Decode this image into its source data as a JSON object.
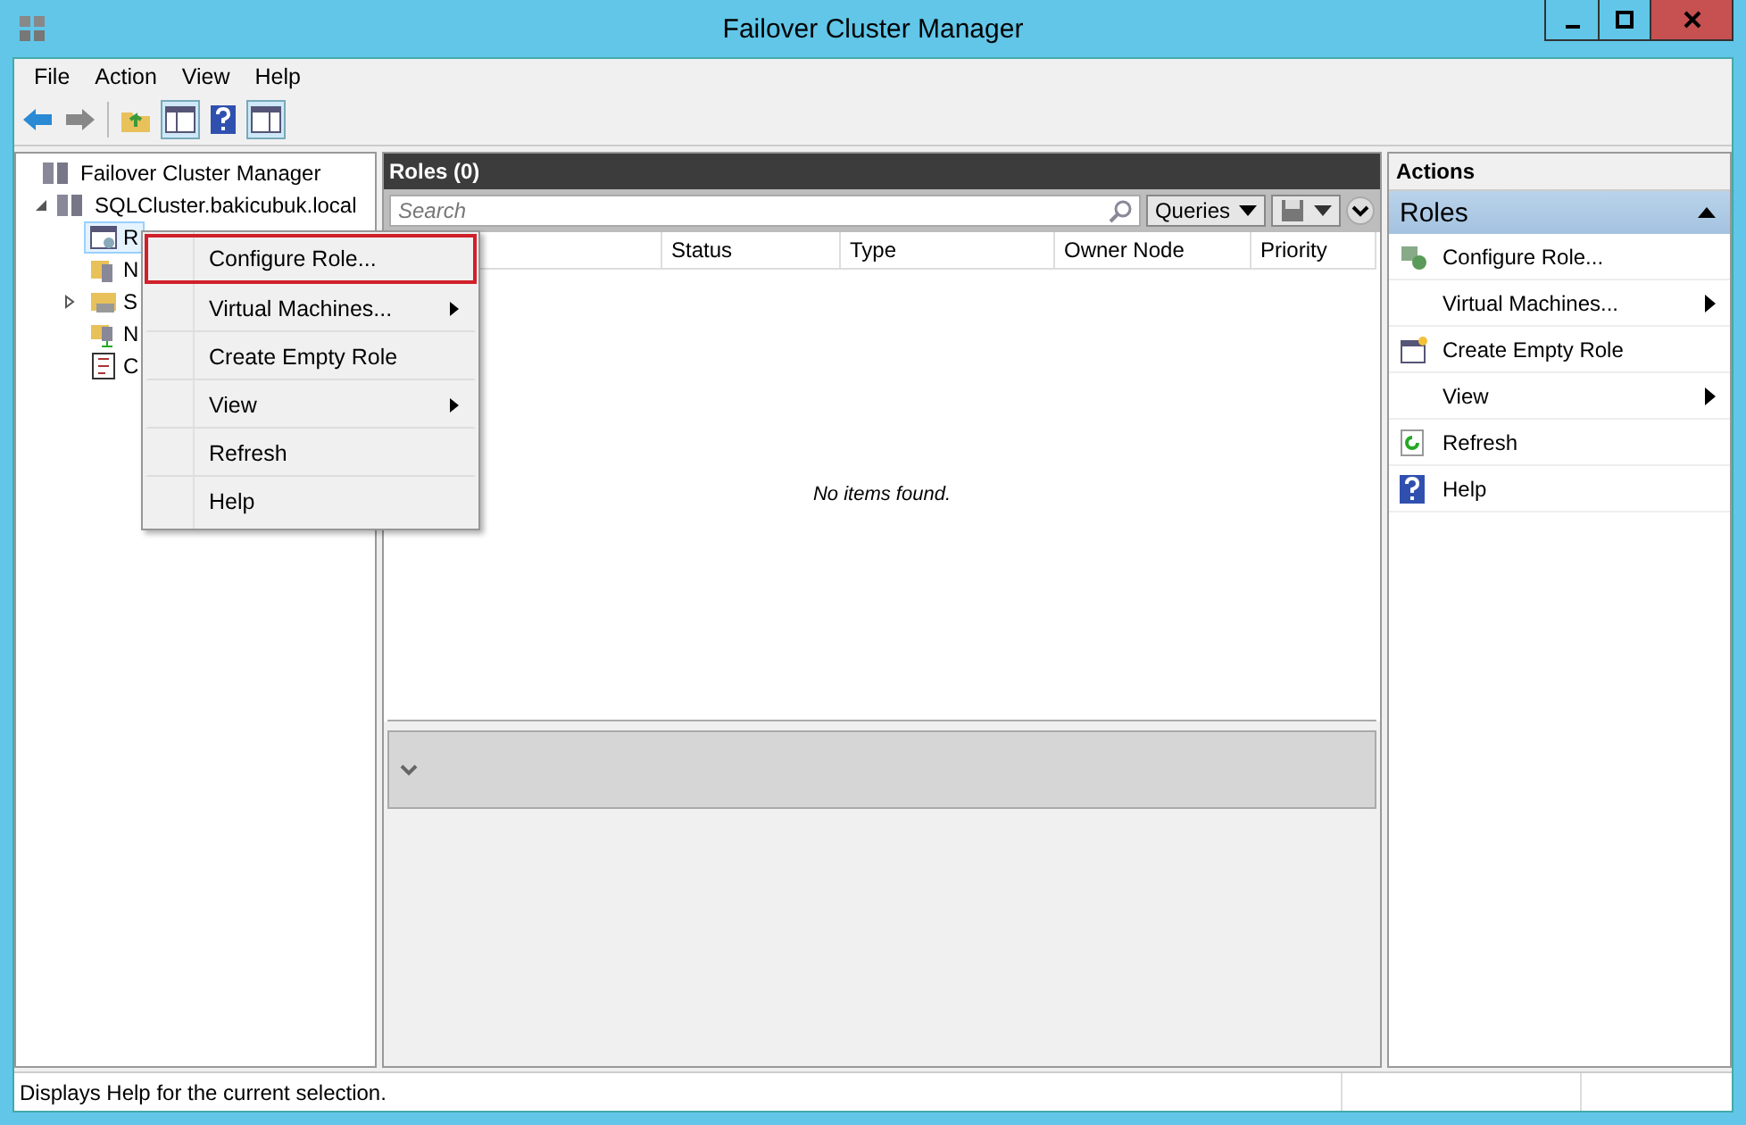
{
  "window": {
    "title": "Failover Cluster Manager"
  },
  "menu_bar": [
    "File",
    "Action",
    "View",
    "Help"
  ],
  "tree": [
    {
      "label": "Failover Cluster Manager",
      "selected": false,
      "children": [
        {
          "label": "SQLCluster.bakicubuk.local",
          "expanded": true,
          "selected": false,
          "children": [
            {
              "label": "R",
              "kind": "roles",
              "selected": true
            },
            {
              "label": "N",
              "kind": "nodes",
              "selected": false
            },
            {
              "label": "S",
              "kind": "storage",
              "selected": false,
              "expandable": true
            },
            {
              "label": "N",
              "kind": "networks",
              "selected": false
            },
            {
              "label": "C",
              "kind": "events",
              "selected": false
            }
          ]
        }
      ]
    }
  ],
  "roles_panel": {
    "title": "Roles (0)",
    "search": {
      "placeholder": "Search"
    },
    "queries_button": "Queries",
    "columns": [
      "Status",
      "Type",
      "Owner Node",
      "Priority"
    ],
    "empty_message": "No items found."
  },
  "context_menu": [
    {
      "label": "Configure Role...",
      "submenu": false,
      "highlighted": true
    },
    {
      "label": "Virtual Machines...",
      "submenu": true,
      "highlighted": false
    },
    {
      "label": "Create Empty Role",
      "submenu": false,
      "highlighted": false
    },
    {
      "label": "View",
      "submenu": true,
      "highlighted": false
    },
    {
      "label": "Refresh",
      "submenu": false,
      "highlighted": false
    },
    {
      "label": "Help",
      "submenu": false,
      "highlighted": false
    }
  ],
  "actions": {
    "title": "Actions",
    "section": "Roles",
    "items": [
      {
        "label": "Configure Role...",
        "kind": "configure",
        "submenu": false
      },
      {
        "label": "Virtual Machines...",
        "kind": "none",
        "submenu": true
      },
      {
        "label": "Create Empty Role",
        "kind": "create",
        "submenu": false
      },
      {
        "label": "View",
        "kind": "none",
        "submenu": true
      },
      {
        "label": "Refresh",
        "kind": "refresh",
        "submenu": false
      },
      {
        "label": "Help",
        "kind": "help",
        "submenu": false
      }
    ]
  },
  "status_bar": "Displays Help for the current selection."
}
